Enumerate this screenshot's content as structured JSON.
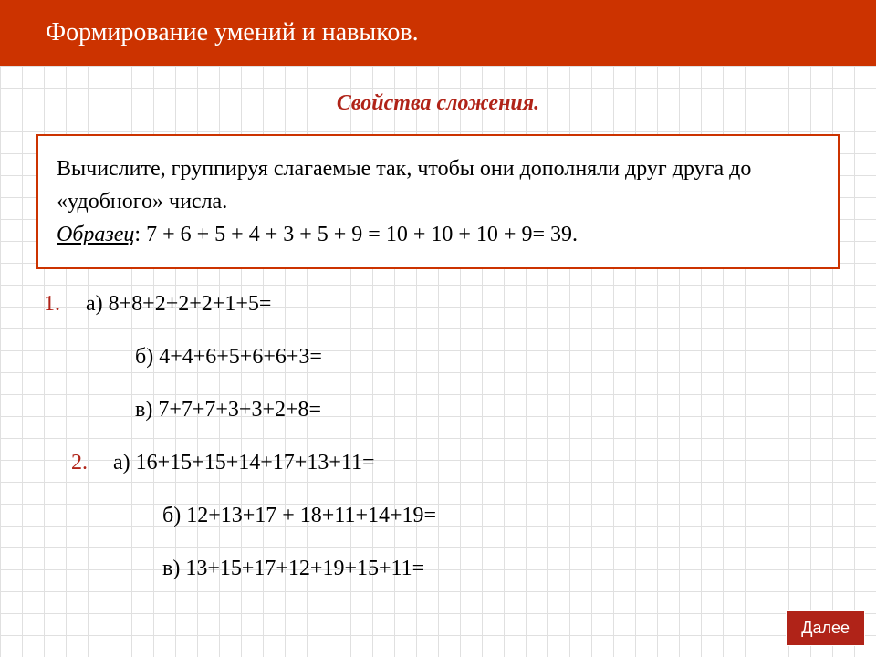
{
  "header": {
    "title": "Формирование умений и навыков."
  },
  "subtitle": "Свойства сложения.",
  "instruction": {
    "text": "Вычислите, группируя слагаемые так, чтобы они дополняли друг друга до «удобного» числа.",
    "sample_label": "Образец",
    "sample_text": ":  7 + 6 + 5 + 4 + 3 + 5 + 9 = 10 + 10 + 10 + 9= 39."
  },
  "problems": {
    "group1": {
      "number": "1.",
      "a": "а) 8+8+2+2+2+1+5=",
      "b": "б) 4+4+6+5+6+6+3=",
      "c": "в) 7+7+7+3+3+2+8="
    },
    "group2": {
      "number": "2.",
      "a": "а) 16+15+15+14+17+13+11=",
      "b": "б) 12+13+17 + 18+11+14+19=",
      "c": "в) 13+15+17+12+19+15+11="
    }
  },
  "next_button": "Далее"
}
